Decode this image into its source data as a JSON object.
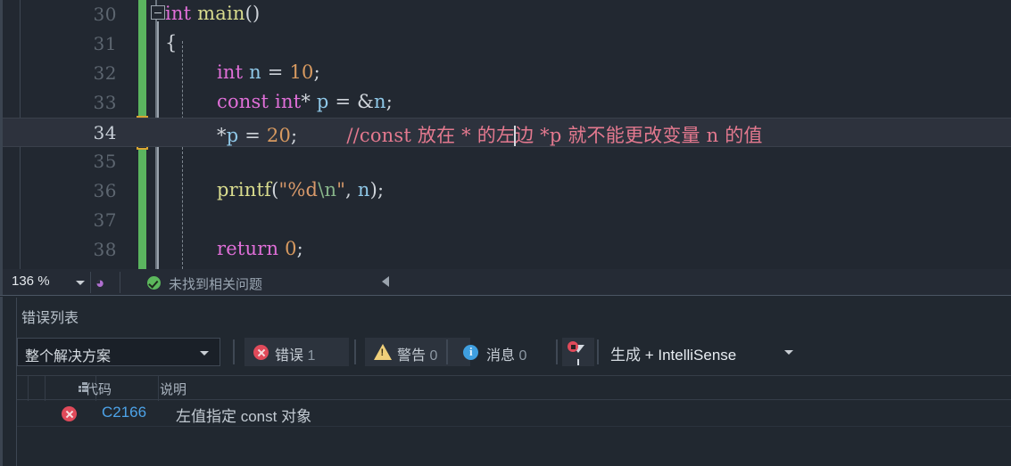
{
  "editor": {
    "language": "c",
    "lines": [
      {
        "number": "30",
        "indent": 0,
        "active": false,
        "fold": true,
        "tokens": [
          {
            "t": "int",
            "c": "type"
          },
          {
            "t": " ",
            "c": "punc"
          },
          {
            "t": "main",
            "c": "fn"
          },
          {
            "t": "()",
            "c": "punc"
          }
        ]
      },
      {
        "number": "31",
        "indent": 0,
        "active": false,
        "fold": false,
        "tokens": [
          {
            "t": "{",
            "c": "punc"
          }
        ]
      },
      {
        "number": "32",
        "indent": 2,
        "active": false,
        "fold": false,
        "tokens": [
          {
            "t": "int",
            "c": "type"
          },
          {
            "t": " n ",
            "c": "var"
          },
          {
            "t": "= ",
            "c": "punc"
          },
          {
            "t": "10",
            "c": "num"
          },
          {
            "t": ";",
            "c": "punc"
          }
        ]
      },
      {
        "number": "33",
        "indent": 2,
        "active": false,
        "fold": false,
        "tokens": [
          {
            "t": "const",
            "c": "kw"
          },
          {
            "t": " ",
            "c": "punc"
          },
          {
            "t": "int",
            "c": "type"
          },
          {
            "t": "* ",
            "c": "punc"
          },
          {
            "t": "p",
            "c": "var"
          },
          {
            "t": " = ",
            "c": "punc"
          },
          {
            "t": "&",
            "c": "punc"
          },
          {
            "t": "n",
            "c": "var"
          },
          {
            "t": ";",
            "c": "punc"
          }
        ]
      },
      {
        "number": "34",
        "indent": 2,
        "active": true,
        "fold": false,
        "tokens": [
          {
            "t": "*",
            "c": "punc"
          },
          {
            "t": "p",
            "c": "var"
          },
          {
            "t": " = ",
            "c": "punc"
          },
          {
            "t": "20",
            "c": "num"
          },
          {
            "t": ";",
            "c": "punc"
          },
          {
            "t": "        ",
            "c": "punc"
          },
          {
            "t": "//const 放在 * 的左",
            "c": "cmt"
          },
          {
            "t": "CARET",
            "c": "caret"
          },
          {
            "t": "边 *p 就不能更改变量 n 的值",
            "c": "cmt"
          }
        ]
      },
      {
        "number": "35",
        "indent": 0,
        "active": false,
        "fold": false,
        "tokens": []
      },
      {
        "number": "36",
        "indent": 2,
        "active": false,
        "fold": false,
        "tokens": [
          {
            "t": "printf",
            "c": "fn"
          },
          {
            "t": "(",
            "c": "punc"
          },
          {
            "t": "\"%d",
            "c": "str"
          },
          {
            "t": "\\n",
            "c": "esc"
          },
          {
            "t": "\"",
            "c": "str"
          },
          {
            "t": ", ",
            "c": "punc"
          },
          {
            "t": "n",
            "c": "var"
          },
          {
            "t": ")",
            "c": "punc"
          },
          {
            "t": ";",
            "c": "punc"
          }
        ]
      },
      {
        "number": "37",
        "indent": 0,
        "active": false,
        "fold": false,
        "tokens": []
      },
      {
        "number": "38",
        "indent": 2,
        "active": false,
        "fold": false,
        "tokens": [
          {
            "t": "return",
            "c": "kw"
          },
          {
            "t": " ",
            "c": "punc"
          },
          {
            "t": "0",
            "c": "num"
          },
          {
            "t": ";",
            "c": "punc"
          }
        ]
      }
    ]
  },
  "statusbar": {
    "zoom_level": "136 %",
    "zoom_caret_icon": "chevron-down-icon",
    "head_icon": "person-head-icon",
    "check_icon": "check-circle-icon",
    "status_text": "未找到相关问题",
    "scroll_left_icon": "scroll-left-arrow-icon"
  },
  "panel": {
    "title": "错误列表",
    "scope_dropdown": {
      "value": "整个解决方案",
      "caret_icon": "chevron-down-icon"
    },
    "counters": [
      {
        "name": "errors",
        "icon": "error-circle-icon",
        "label": "错误",
        "count": "1",
        "active": true
      },
      {
        "name": "warnings",
        "icon": "warning-triangle-icon",
        "label": "警告",
        "count": "0",
        "active": false
      },
      {
        "name": "messages",
        "icon": "info-circle-icon",
        "label": "消息",
        "count": "0",
        "active": false
      }
    ],
    "filter_button": {
      "icon": "filter-funnel-icon",
      "badge_icon": "red-dot-badge"
    },
    "build_dropdown": {
      "value_cn": "生成",
      "value_sep": " + ",
      "value_en": "IntelliSense",
      "caret_icon": "chevron-down-icon"
    },
    "table": {
      "severity_sort_icon": "severity-sort-icon",
      "columns": [
        "代码",
        "说明"
      ],
      "rows": [
        {
          "severity_icon": "error-circle-icon",
          "code": "C2166",
          "description": "左值指定 const 对象"
        }
      ]
    }
  },
  "colors": {
    "editor_bg": "#222831",
    "panel_bg": "#212830",
    "active_line": "#2d323d",
    "change_bar_green": "#5bb55f",
    "bookmark_gold": "#d8a431",
    "error_red": "#e04a5a",
    "warning_yellow": "#f0d07a",
    "info_blue": "#3f9fe0",
    "link_blue": "#4da3e8",
    "comment_pink": "#e4798f",
    "keyword_magenta": "#e06fd8",
    "success_green": "#5cb85c"
  }
}
